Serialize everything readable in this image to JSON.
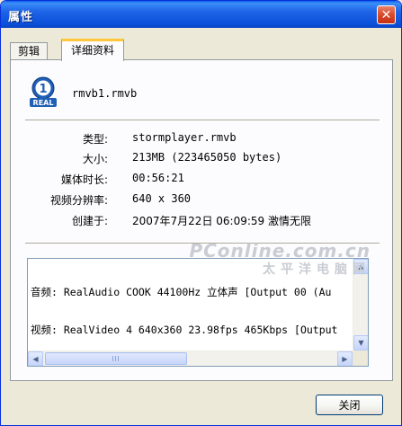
{
  "window": {
    "title": "属性",
    "close_glyph": "✕"
  },
  "tabs": [
    {
      "label": "剪辑",
      "active": false
    },
    {
      "label": "详细资料",
      "active": true
    }
  ],
  "file": {
    "icon": "real-media-icon",
    "icon_text": "REAL",
    "icon_digit": "1",
    "name": "rmvb1.rmvb"
  },
  "properties": [
    {
      "label": "类型:",
      "value": "stormplayer.rmvb"
    },
    {
      "label": "大小:",
      "value": "213MB (223465050 bytes)"
    },
    {
      "label": "媒体时长:",
      "value": "00:56:21"
    },
    {
      "label": "视频分辨率:",
      "value": "640 x 360"
    },
    {
      "label": "创建于:",
      "value": "2007年7月22日 06:09:59 激情无限"
    }
  ],
  "stream_info": {
    "lines": [
      "音频: RealAudio COOK 44100Hz 立体声 [Output 00 (Au",
      "视频: RealVideo 4 640x360 23.98fps 465Kbps [Output"
    ]
  },
  "watermark": {
    "main": "PConline.com.cn",
    "sub": "太平洋电脑网"
  },
  "buttons": {
    "close_label": "关闭"
  },
  "colors": {
    "title_bar": "#0A4FD8",
    "active_tab_accent": "#FFC83C",
    "window_bg": "#ECE9D8"
  }
}
